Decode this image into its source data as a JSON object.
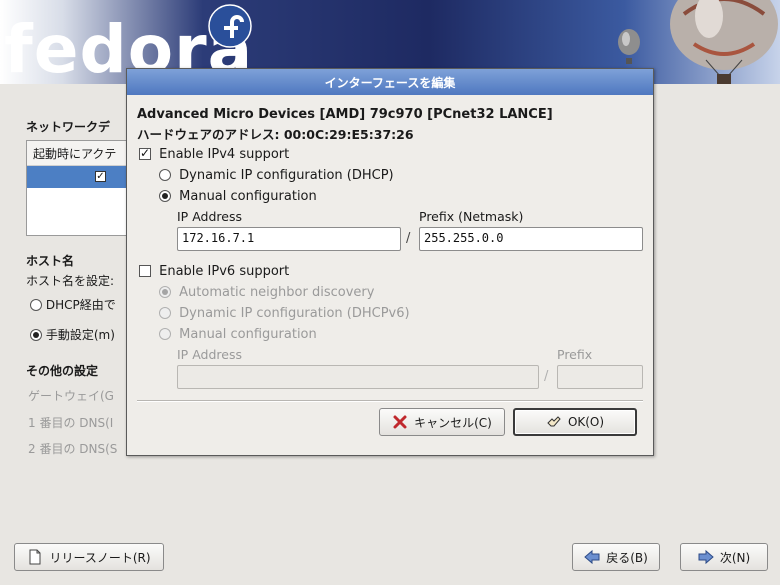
{
  "banner": {
    "logo_text": "fedora"
  },
  "background": {
    "network_devices_heading": "ネットワークデ",
    "device_list": {
      "column_header": "起動時にアクテ"
    },
    "hostname_heading": "ホスト名",
    "hostname_set_label": "ホスト名を設定:",
    "dhcp_radio": "DHCP経由で",
    "manual_radio": "手動設定(m)",
    "other_settings_heading": "その他の設定",
    "gateway_label": "ゲートウェイ(G",
    "dns1_label": "1 番目の DNS(I",
    "dns2_label": "2 番目の DNS(S"
  },
  "footer": {
    "release_notes_label": "リリースノート(R)",
    "back_label": "戻る(B)",
    "next_label": "次(N)"
  },
  "dialog": {
    "title": "インターフェースを編集",
    "device_name": "Advanced Micro Devices [AMD] 79c970 [PCnet32 LANCE]",
    "hw_address": "ハードウェアのアドレス: 00:0C:29:E5:37:26",
    "ipv4": {
      "enable_label": "Enable IPv4 support",
      "enabled": true,
      "dhcp_label": "Dynamic IP configuration (DHCP)",
      "manual_label": "Manual configuration",
      "selected": "manual",
      "ip_address_label": "IP Address",
      "prefix_label": "Prefix (Netmask)",
      "ip_address_value": "172.16.7.1",
      "prefix_value": "255.255.0.0",
      "separator": "/"
    },
    "ipv6": {
      "enable_label": "Enable IPv6 support",
      "enabled": false,
      "auto_label": "Automatic neighbor discovery",
      "dhcpv6_label": "Dynamic IP configuration (DHCPv6)",
      "manual_label": "Manual configuration",
      "selected": "auto",
      "ip_address_label": "IP Address",
      "prefix_label": "Prefix",
      "ip_address_value": "",
      "prefix_value": "",
      "separator": "/"
    },
    "cancel_label": "キャンセル(C)",
    "ok_label": "OK(O)"
  },
  "colors": {
    "title_bar": "#5b82c6",
    "selection": "#4c7fc4",
    "dialog_bg": "#efede9",
    "page_bg": "#e8e6e2"
  },
  "icons": [
    "fedora-logo-icon",
    "balloon-icon",
    "document-icon",
    "cancel-x-icon",
    "ok-hand-icon",
    "back-arrow-icon",
    "next-arrow-icon"
  ]
}
